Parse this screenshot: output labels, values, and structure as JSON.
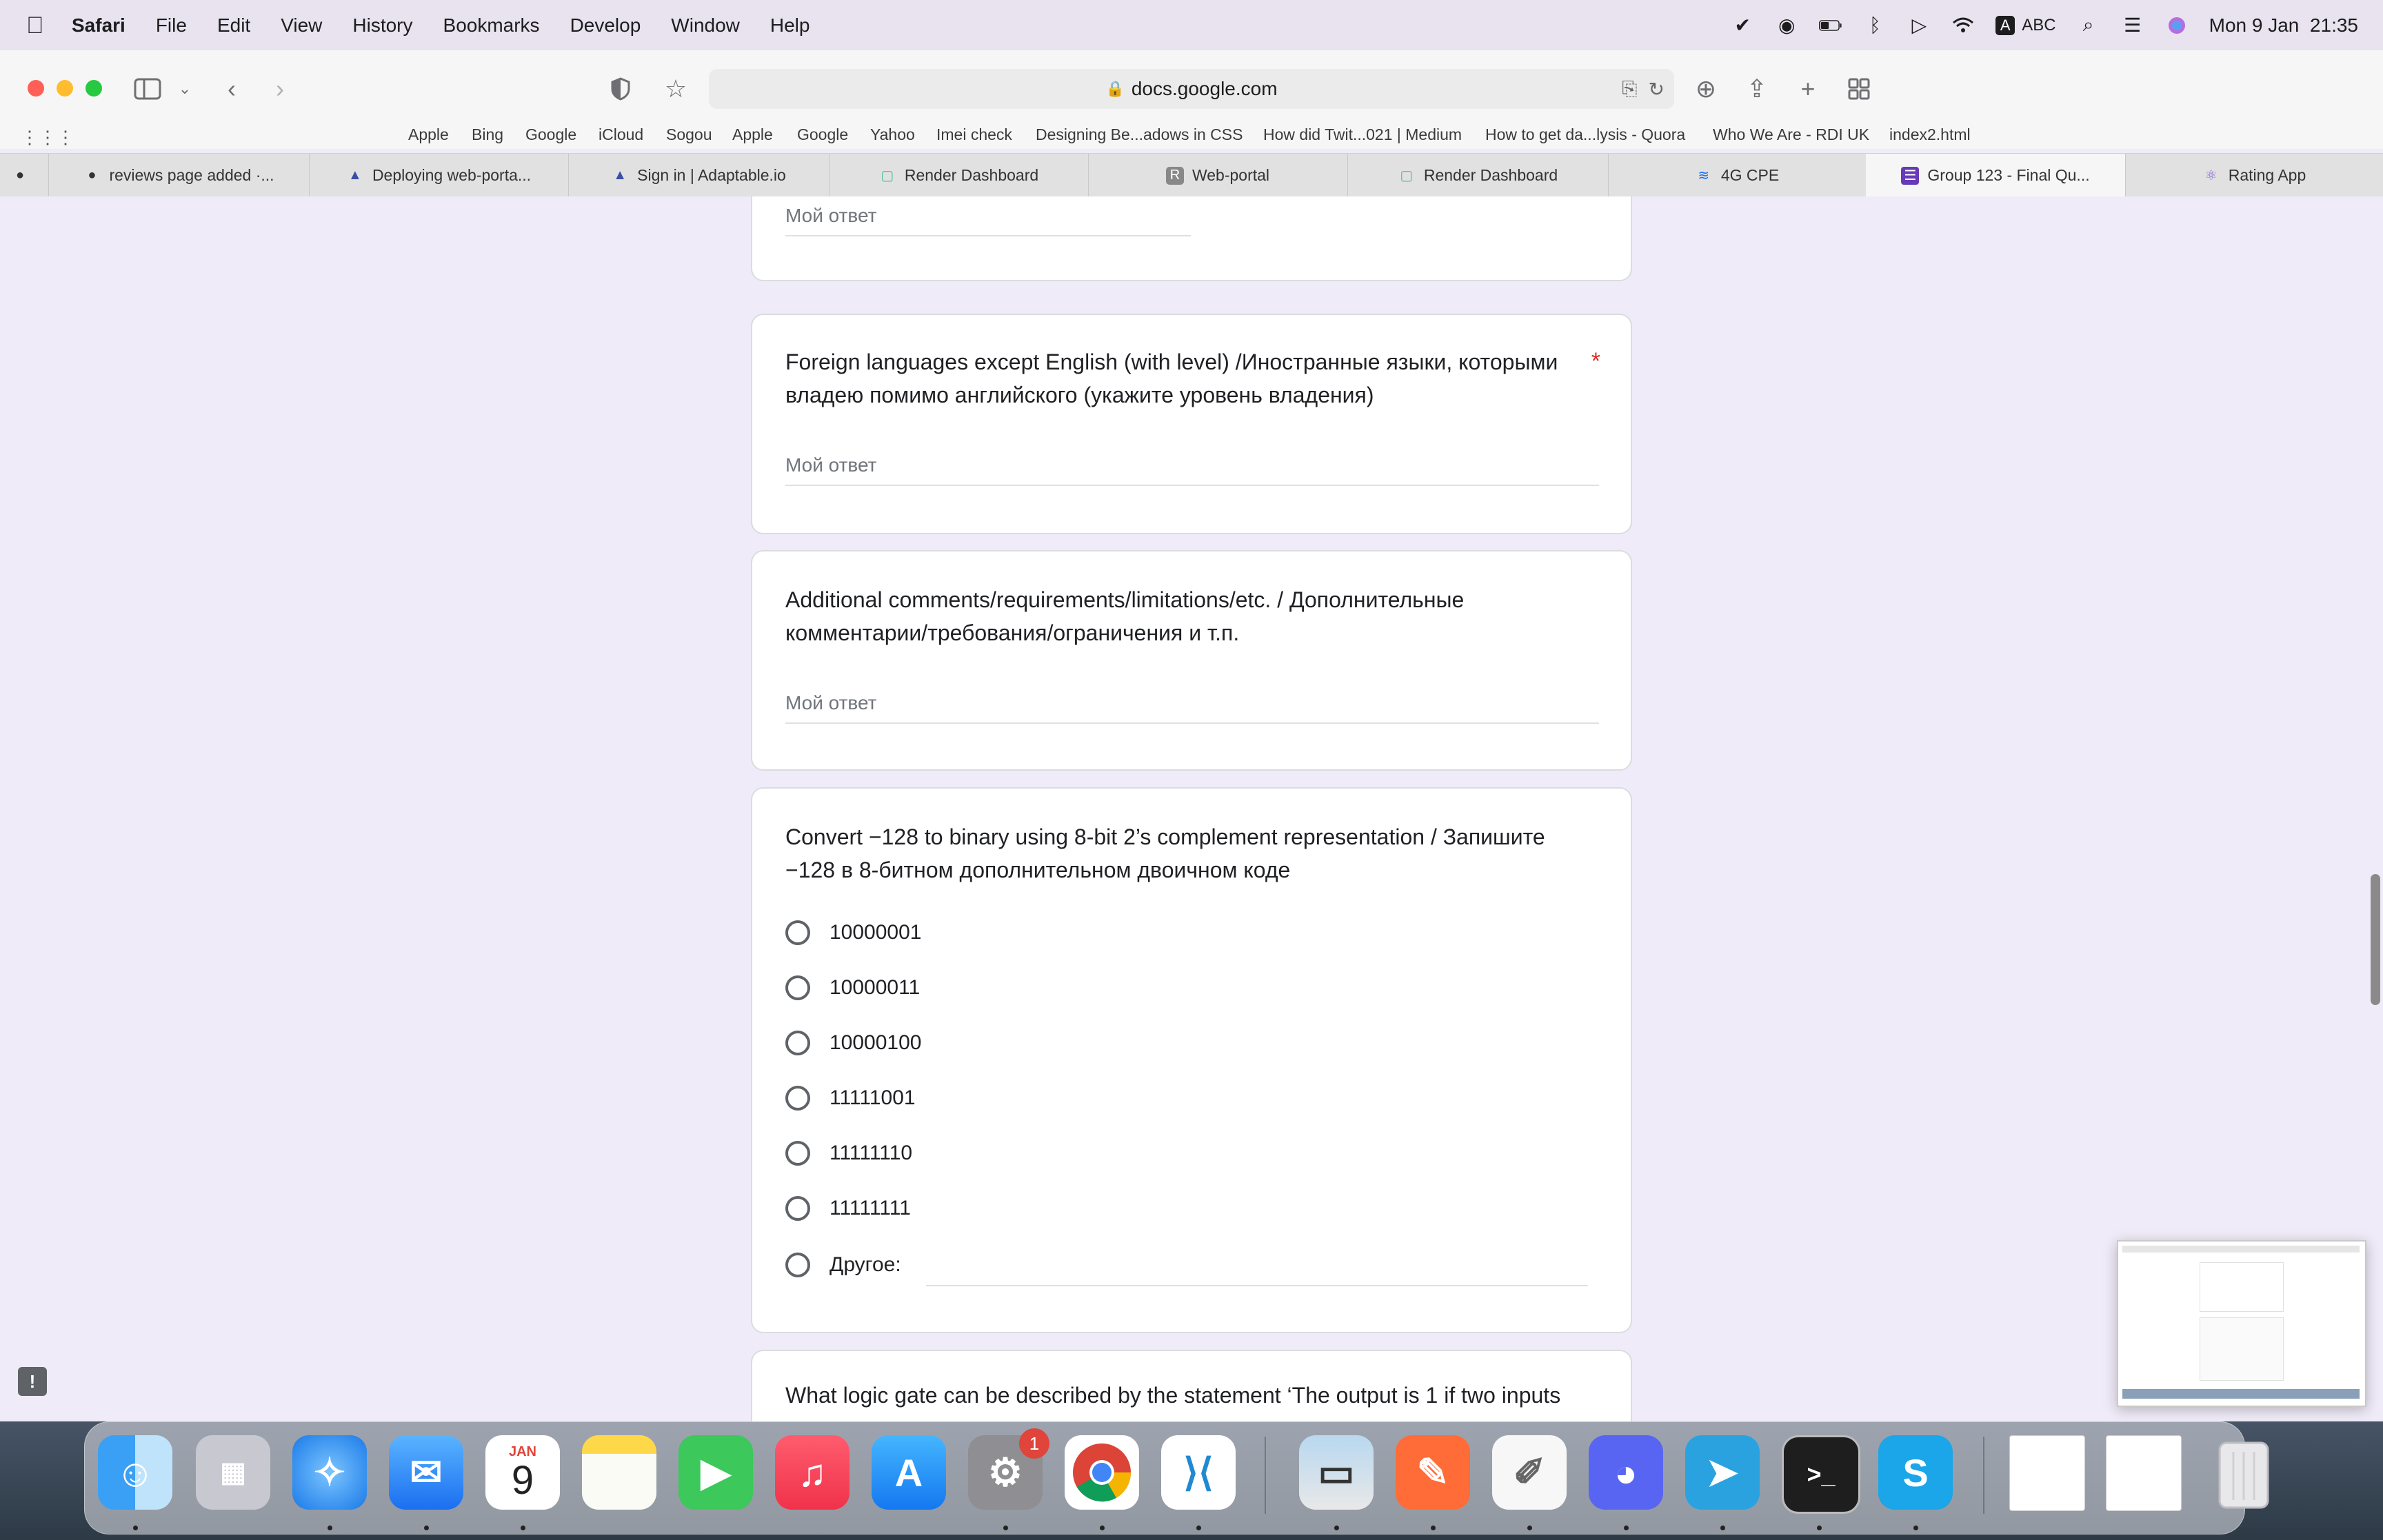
{
  "menubar": {
    "app_name": "Safari",
    "items": [
      "File",
      "Edit",
      "View",
      "History",
      "Bookmarks",
      "Develop",
      "Window",
      "Help"
    ],
    "keyboard": "ABC",
    "datetime": "Mon 9 Jan  21:35"
  },
  "toolbar": {
    "url": "docs.google.com"
  },
  "bookmarks": [
    "Apple",
    "Bing",
    "Google",
    "iCloud",
    "Sogou",
    "Apple",
    "Google",
    "Yahoo",
    "Imei check",
    "Designing Be...adows in CSS",
    "How did Twit...021 | Medium",
    "How to get da...lysis - Quora",
    "Who We Are - RDI UK",
    "index2.html"
  ],
  "tabs": [
    {
      "label": "reviews page added ·...",
      "icon": "github-icon"
    },
    {
      "label": "Deploying web-porta...",
      "icon": "adaptable-icon"
    },
    {
      "label": "Sign in | Adaptable.io",
      "icon": "adaptable-icon"
    },
    {
      "label": "Render Dashboard",
      "icon": "render-icon"
    },
    {
      "label": "Web-portal",
      "icon": "r-icon"
    },
    {
      "label": "Render Dashboard",
      "icon": "render-icon"
    },
    {
      "label": "4G CPE",
      "icon": "wifi-icon"
    },
    {
      "label": "Group 123 - Final Qu...",
      "icon": "forms-icon"
    },
    {
      "label": "Rating App",
      "icon": "rating-icon"
    }
  ],
  "form": {
    "answer_placeholder": "Мой ответ",
    "q1_text": "Foreign languages except English (with level) /Иностранные языки, которыми владею помимо английского (укажите уровень владения)",
    "q1_required": "*",
    "q2_text": "Additional comments/requirements/limitations/etc. / Дополнительные комментарии/требования/ограничения и т.п.",
    "q3_text": "Convert −128 to binary using 8-bit 2’s complement representation / Запишите −128 в 8-битном дополнительном двоичном коде",
    "q3_options": [
      "10000001",
      "10000011",
      "10000100",
      "11111001",
      "11111110",
      "11111111"
    ],
    "q3_other": "Другое:",
    "q4_text": "What logic gate can be described by the statement ‘The output is 1 if two inputs"
  },
  "calendar": {
    "month": "JAN",
    "day": "9"
  },
  "settings_badge": "1",
  "colors": {
    "form_bg": "#f0ebf8",
    "required": "#d93025"
  }
}
